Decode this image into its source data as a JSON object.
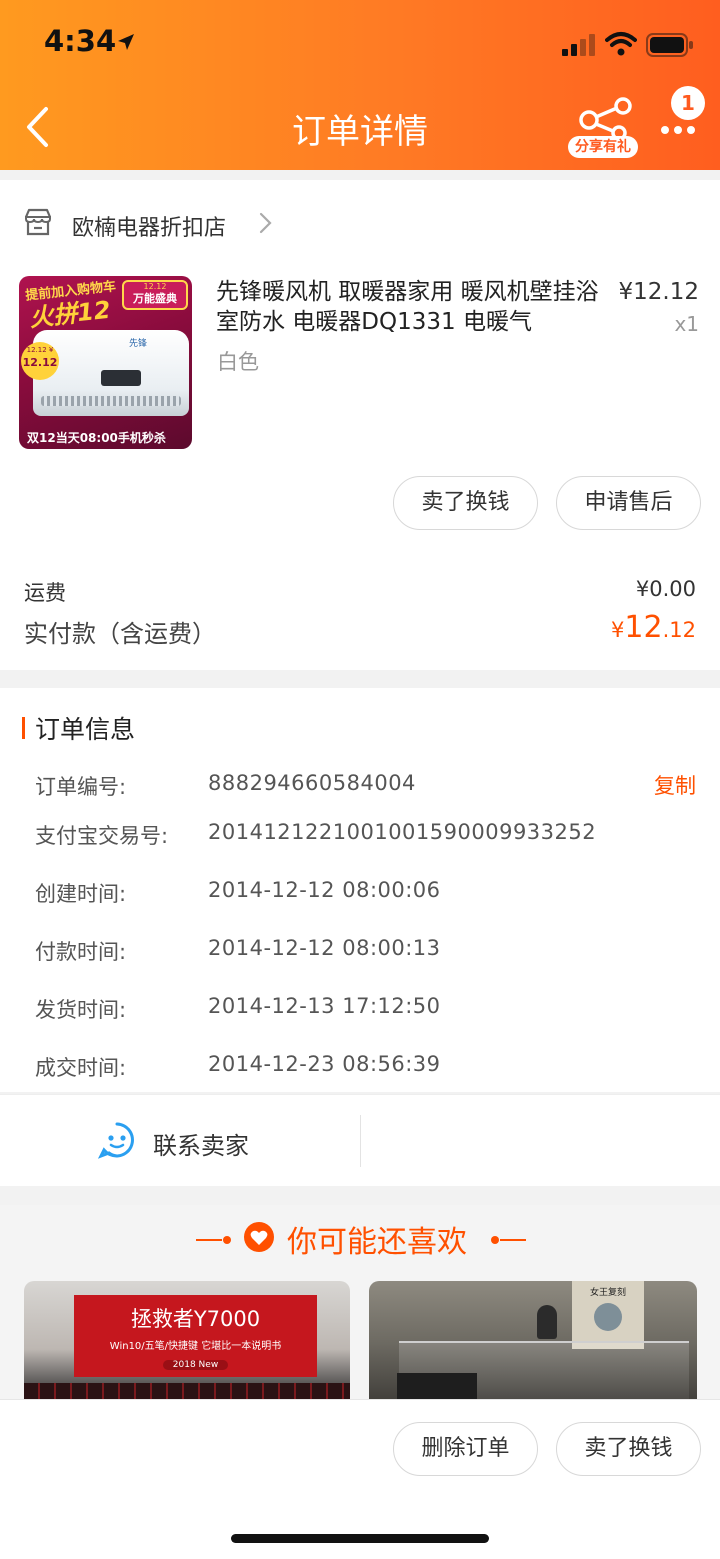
{
  "status_bar": {
    "time": "4:34"
  },
  "nav": {
    "title": "订单详情",
    "share_label": "分享有礼",
    "more_badge": "1"
  },
  "shop": {
    "name": "欧楠电器折扣店"
  },
  "product": {
    "title": "先锋暖风机 取暖器家用 暖风机壁挂浴室防水 电暖器DQ1331 电暖气",
    "variant": "白色",
    "price": "¥12.12",
    "quantity": "x1",
    "thumb_text": {
      "banner": "提前加入购物车",
      "big": "火拼12",
      "badge_top": "12.12",
      "badge_main": "万能盛典",
      "brand": "先锋",
      "tag_top": "12.12 ¥",
      "tag": "12.12",
      "bottom": "双12当天08:00手机秒杀"
    }
  },
  "item_actions": {
    "sell": "卖了换钱",
    "after_sale": "申请售后"
  },
  "totals": {
    "shipping_label": "运费",
    "shipping_value": "¥0.00",
    "paid_label": "实付款（含运费）",
    "paid_currency": "¥",
    "paid_int": "12",
    "paid_dec": ".12"
  },
  "order_info": {
    "heading": "订单信息",
    "copy_label": "复制",
    "rows": [
      {
        "label": "订单编号:",
        "value": "888294660584004"
      },
      {
        "label": "支付宝交易号:",
        "value": "2014121221001001590009933252"
      },
      {
        "label": "创建时间:",
        "value": "2014-12-12 08:00:06"
      },
      {
        "label": "付款时间:",
        "value": "2014-12-12 08:00:13"
      },
      {
        "label": "发货时间:",
        "value": "2014-12-13 17:12:50"
      },
      {
        "label": "成交时间:",
        "value": "2014-12-23 08:56:39"
      }
    ]
  },
  "contact": {
    "label": "联系卖家"
  },
  "recommend": {
    "title": "你可能还喜欢",
    "card1": {
      "title": "拯救者Y7000",
      "subtitle": "Win10/五笔/快捷键 它堪比一本说明书",
      "tag": "2018 New"
    },
    "card2": {
      "title": "女王复刻"
    }
  },
  "bottom_bar": {
    "delete": "删除订单",
    "sell": "卖了换钱"
  },
  "colors": {
    "accent": "#ff5000",
    "header_start": "#ff9a1f",
    "header_end": "#ff5e1f"
  }
}
